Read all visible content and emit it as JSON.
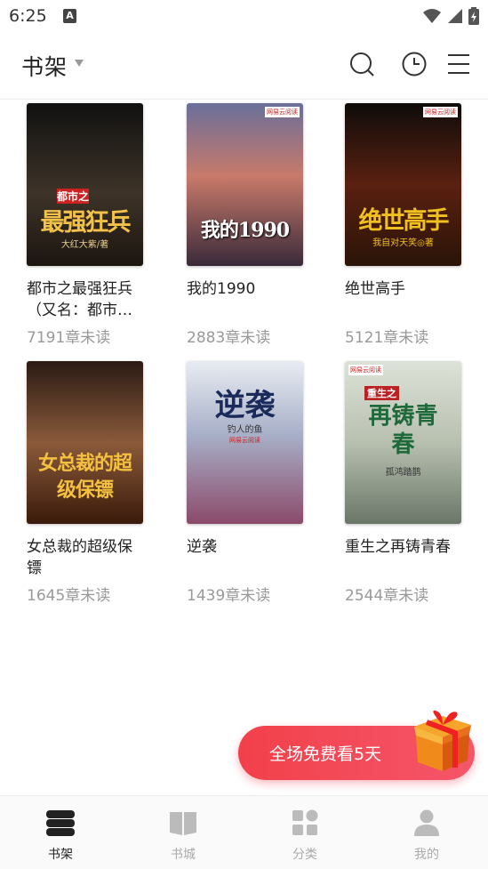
{
  "status_bar": {
    "time": "6:25",
    "notification_letter": "A"
  },
  "header": {
    "title": "书架"
  },
  "books": [
    {
      "title": "都市之最强狂兵（又名：都市…",
      "unread": "7191章未读",
      "cover_title": "最强狂兵",
      "cover_sub": "都市之",
      "cover_author": "大红大紫/著",
      "cover_colors": [
        "#1b1b1b",
        "#5a4a3a"
      ]
    },
    {
      "title": "我的1990",
      "unread": "2883章未读",
      "cover_title": "我的1990",
      "cover_sub": "",
      "cover_author": "",
      "cover_badge": "网易云阅读",
      "cover_colors": [
        "#7d7fa6",
        "#c95c4a"
      ]
    },
    {
      "title": "绝世高手",
      "unread": "5121章未读",
      "cover_title": "绝世高手",
      "cover_sub": "",
      "cover_author": "我自对天笑◎著",
      "cover_badge": "网易云阅读",
      "cover_colors": [
        "#1a1410",
        "#7a2a10"
      ]
    },
    {
      "title": "女总裁的超级保镖",
      "unread": "1645章未读",
      "cover_title": "女总裁的超级保镖",
      "cover_sub": "",
      "cover_author": "",
      "cover_colors": [
        "#3a1a10",
        "#a06030"
      ]
    },
    {
      "title": "逆袭",
      "unread": "1439章未读",
      "cover_title": "逆袭",
      "cover_sub": "钓人的鱼",
      "cover_author": "",
      "cover_badge": "网易云阅读",
      "cover_colors": [
        "#cfd8e8",
        "#8a6a9a"
      ]
    },
    {
      "title": "重生之再铸青春",
      "unread": "2544章未读",
      "cover_title": "再铸青春",
      "cover_sub": "重生之",
      "cover_author": "孤鸿踏鹊",
      "cover_badge": "网易云阅读",
      "cover_colors": [
        "#d8dcd0",
        "#6a7a68"
      ]
    }
  ],
  "promo": {
    "label": "全场免费看5天"
  },
  "nav": [
    {
      "label": "书架",
      "icon": "bookshelf-icon",
      "active": true
    },
    {
      "label": "书城",
      "icon": "book-icon",
      "active": false
    },
    {
      "label": "分类",
      "icon": "category-icon",
      "active": false
    },
    {
      "label": "我的",
      "icon": "profile-icon",
      "active": false
    }
  ],
  "colors": {
    "accent": "#f2404a",
    "muted": "#999999"
  }
}
